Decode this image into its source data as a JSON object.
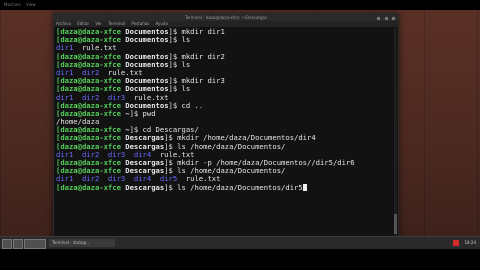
{
  "topbar": {
    "items": [
      "Machine",
      "View"
    ]
  },
  "window": {
    "title": "Terminal - daza@daza-xfce: ~/Descargas",
    "menu": [
      "Archivo",
      "Editar",
      "Ver",
      "Terminal",
      "Pestañas",
      "Ayuda"
    ]
  },
  "terminal": {
    "lines": [
      [
        {
          "t": "[daza@daza-xfce ",
          "c": "p-user"
        },
        {
          "t": "Documentos",
          "c": "p-path"
        },
        {
          "t": "]$ mkdir dir1",
          "c": "file"
        }
      ],
      [
        {
          "t": "[daza@daza-xfce ",
          "c": "p-user"
        },
        {
          "t": "Documentos",
          "c": "p-path"
        },
        {
          "t": "]$ ls",
          "c": "file"
        }
      ],
      [
        {
          "t": "dir1",
          "c": "dir"
        },
        {
          "t": "  rule.txt",
          "c": "file"
        }
      ],
      [
        {
          "t": "[daza@daza-xfce ",
          "c": "p-user"
        },
        {
          "t": "Documentos",
          "c": "p-path"
        },
        {
          "t": "]$ mkdir dir2",
          "c": "file"
        }
      ],
      [
        {
          "t": "[daza@daza-xfce ",
          "c": "p-user"
        },
        {
          "t": "Documentos",
          "c": "p-path"
        },
        {
          "t": "]$ ls",
          "c": "file"
        }
      ],
      [
        {
          "t": "dir1  dir2",
          "c": "dir"
        },
        {
          "t": "  rule.txt",
          "c": "file"
        }
      ],
      [
        {
          "t": "[daza@daza-xfce ",
          "c": "p-user"
        },
        {
          "t": "Documentos",
          "c": "p-path"
        },
        {
          "t": "]$ mkdir dir3",
          "c": "file"
        }
      ],
      [
        {
          "t": "[daza@daza-xfce ",
          "c": "p-user"
        },
        {
          "t": "Documentos",
          "c": "p-path"
        },
        {
          "t": "]$ ls",
          "c": "file"
        }
      ],
      [
        {
          "t": "dir1  dir2  dir3",
          "c": "dir"
        },
        {
          "t": "  rule.txt",
          "c": "file"
        }
      ],
      [
        {
          "t": "[daza@daza-xfce ",
          "c": "p-user"
        },
        {
          "t": "Documentos",
          "c": "p-path"
        },
        {
          "t": "]$ cd ..",
          "c": "file"
        }
      ],
      [
        {
          "t": "[daza@daza-xfce ",
          "c": "p-user"
        },
        {
          "t": "~",
          "c": "p-path"
        },
        {
          "t": "]$ pwd",
          "c": "file"
        }
      ],
      [
        {
          "t": "/home/daza",
          "c": "file"
        }
      ],
      [
        {
          "t": "[daza@daza-xfce ",
          "c": "p-user"
        },
        {
          "t": "~",
          "c": "p-path"
        },
        {
          "t": "]$ cd Descargas/",
          "c": "file"
        }
      ],
      [
        {
          "t": "[daza@daza-xfce ",
          "c": "p-user"
        },
        {
          "t": "Descargas",
          "c": "p-path"
        },
        {
          "t": "]$ mkdir /home/daza/Documentos/dir4",
          "c": "file"
        }
      ],
      [
        {
          "t": "[daza@daza-xfce ",
          "c": "p-user"
        },
        {
          "t": "Descargas",
          "c": "p-path"
        },
        {
          "t": "]$ ls /home/daza/Documentos/",
          "c": "file"
        }
      ],
      [
        {
          "t": "dir1  dir2  dir3  dir4",
          "c": "dir"
        },
        {
          "t": "  rule.txt",
          "c": "file"
        }
      ],
      [
        {
          "t": "[daza@daza-xfce ",
          "c": "p-user"
        },
        {
          "t": "Descargas",
          "c": "p-path"
        },
        {
          "t": "]$ mkdir -p /home/daza/Documentos//dir5/dir6",
          "c": "file"
        }
      ],
      [
        {
          "t": "[daza@daza-xfce ",
          "c": "p-user"
        },
        {
          "t": "Descargas",
          "c": "p-path"
        },
        {
          "t": "]$ ls /home/daza/Documentos/",
          "c": "file"
        }
      ],
      [
        {
          "t": "dir1  dir2  dir3  dir4  dir5",
          "c": "dir"
        },
        {
          "t": "  rule.txt",
          "c": "file"
        }
      ],
      [
        {
          "t": "[daza@daza-xfce ",
          "c": "p-user"
        },
        {
          "t": "Descargas",
          "c": "p-path"
        },
        {
          "t": "]$ ls /home/daza/Documentos/dir5",
          "c": "file"
        }
      ]
    ]
  },
  "taskbar": {
    "task_label": "Terminal - daza@...",
    "clock": "18:24"
  },
  "colors": {
    "prompt": "#56d05a",
    "directory": "#6b6bff",
    "background": "#121212"
  }
}
